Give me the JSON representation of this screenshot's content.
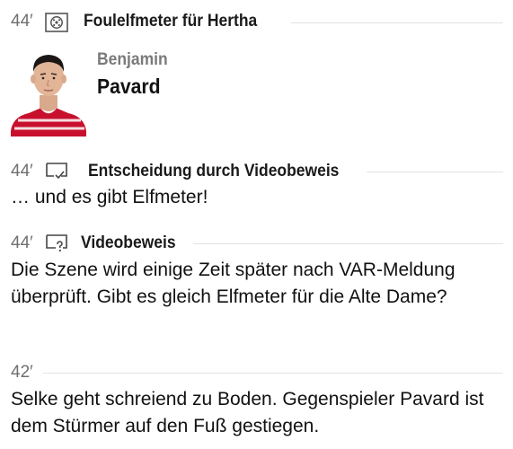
{
  "events": [
    {
      "minute": "44′",
      "icon": "penalty-icon",
      "title": "Foulelfmeter für Hertha",
      "player": {
        "first_name": "Benjamin",
        "last_name": "Pavard"
      }
    },
    {
      "minute": "44′",
      "icon": "var-decision-icon",
      "title": "Entscheidung durch Videobeweis",
      "text": "… und es gibt Elfmeter!"
    },
    {
      "minute": "44′",
      "icon": "var-review-icon",
      "title": "Videobeweis",
      "text": "Die Szene wird einige Zeit später nach VAR-Meldung überprüft. Gibt es gleich Elfmeter für die Alte Dame?"
    },
    {
      "minute": "42′",
      "text": "Selke geht schreiend zu Boden. Gegenspieler Pavard ist dem Stürmer auf den Fuß gestiegen."
    }
  ],
  "colors": {
    "jersey": "#c8102e",
    "muted": "#6f6f6f",
    "rule": "#e2e2e2"
  }
}
